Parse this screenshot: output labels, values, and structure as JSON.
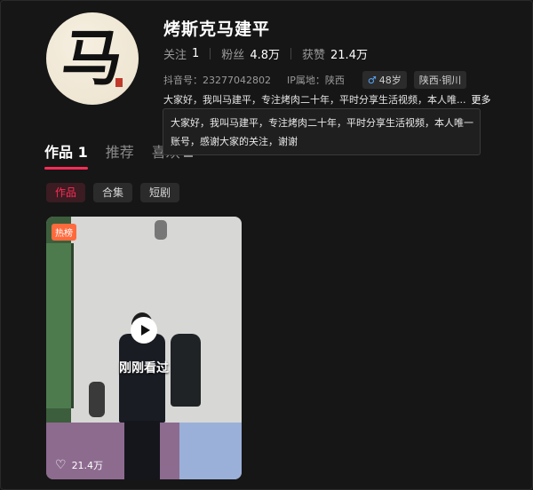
{
  "profile": {
    "avatar_text": "马",
    "name": "烤斯克马建平",
    "stats": [
      {
        "label": "关注",
        "value": "1"
      },
      {
        "label": "粉丝",
        "value": "4.8万"
      },
      {
        "label": "获赞",
        "value": "21.4万"
      }
    ],
    "douyin_id": "抖音号：23277042802",
    "ip": "IP属地：陕西",
    "gender_icon": "male-icon",
    "age": "48岁",
    "location": "陕西·铜川",
    "bio": "大家好，我叫马建平，专注烤肉二十年，平时分享生活视频，本人唯...",
    "more_label": "更多",
    "bio_full_line1": "大家好，我叫马建平，专注烤肉二十年，平时分享生活视频，本人唯一",
    "bio_full_line2": "账号，感谢大家的关注，谢谢"
  },
  "tabs": [
    {
      "label": "作品",
      "count": "1"
    },
    {
      "label": "推荐"
    },
    {
      "label": "喜欢"
    }
  ],
  "filters": [
    "作品",
    "合集",
    "短剧"
  ],
  "video": {
    "badge": "热榜",
    "seen_label": "刚刚看过",
    "likes": "21.4万",
    "play_icon": "play-icon",
    "heart_icon": "heart-icon"
  },
  "colors": {
    "accent": "#fe2c55",
    "background": "#161616"
  }
}
